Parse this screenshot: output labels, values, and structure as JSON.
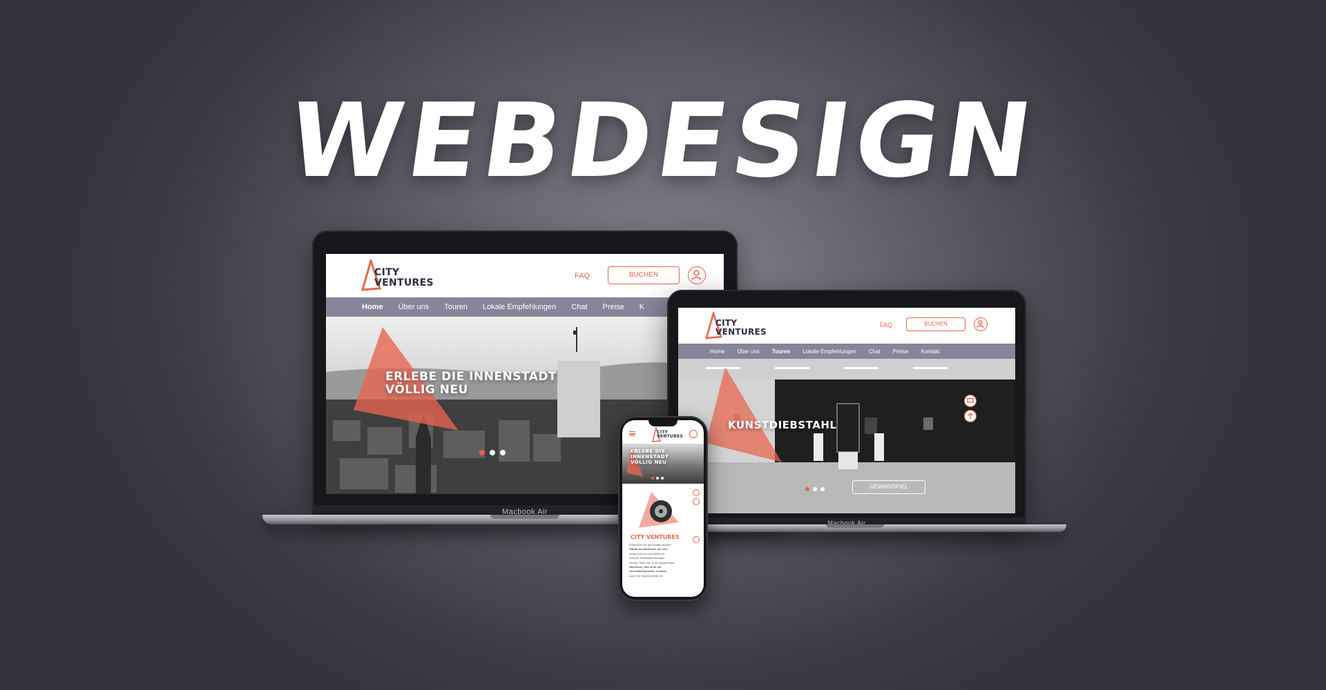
{
  "headline": "WEBDESIGN",
  "brand": {
    "logo_line1": "CITY",
    "logo_line2": "VENTURES",
    "accent": "#e8644f",
    "nav_bg": "#878599"
  },
  "header": {
    "faq_label": "FAQ",
    "book_label": "BUCHEN"
  },
  "laptop_large": {
    "model_label": "Macbook Air",
    "nav": [
      "Home",
      "Über uns",
      "Touren",
      "Lokale Empfehlungen",
      "Chat",
      "Preise",
      "K"
    ],
    "active_index": 0,
    "hero_line1": "ERLEBE DIE INNENSTADT",
    "hero_line2": "VÖLLIG NEU"
  },
  "laptop_small": {
    "model_label": "Macbook Air",
    "nav": [
      "Home",
      "Über uns",
      "Touren",
      "Lokale Empfehlungen",
      "Chat",
      "Preise",
      "Kontakt"
    ],
    "active_index": 2,
    "hero_title": "KUNSTDIEBSTAHL",
    "cta_label": "GEWINNSPIEL"
  },
  "phone": {
    "hero_line1": "ERLEBE DIE",
    "hero_line2": "INNENSTADT",
    "hero_line3": "VÖLLIG NEU",
    "section_title": "CITY VENTURES",
    "body_text": [
      "Entdecken Sie die facettenreichen",
      "Städte am Bodensee auf eine",
      "völlig neue Art und Weise mit",
      "unseren Stadtrallyes/Escape",
      "Touren. Seien Sie in ein spannendes",
      "Abenteuer, das nicht nur",
      "Unterhaltung bietet, sondern",
      "auch eine faszinierende Art ..."
    ]
  }
}
